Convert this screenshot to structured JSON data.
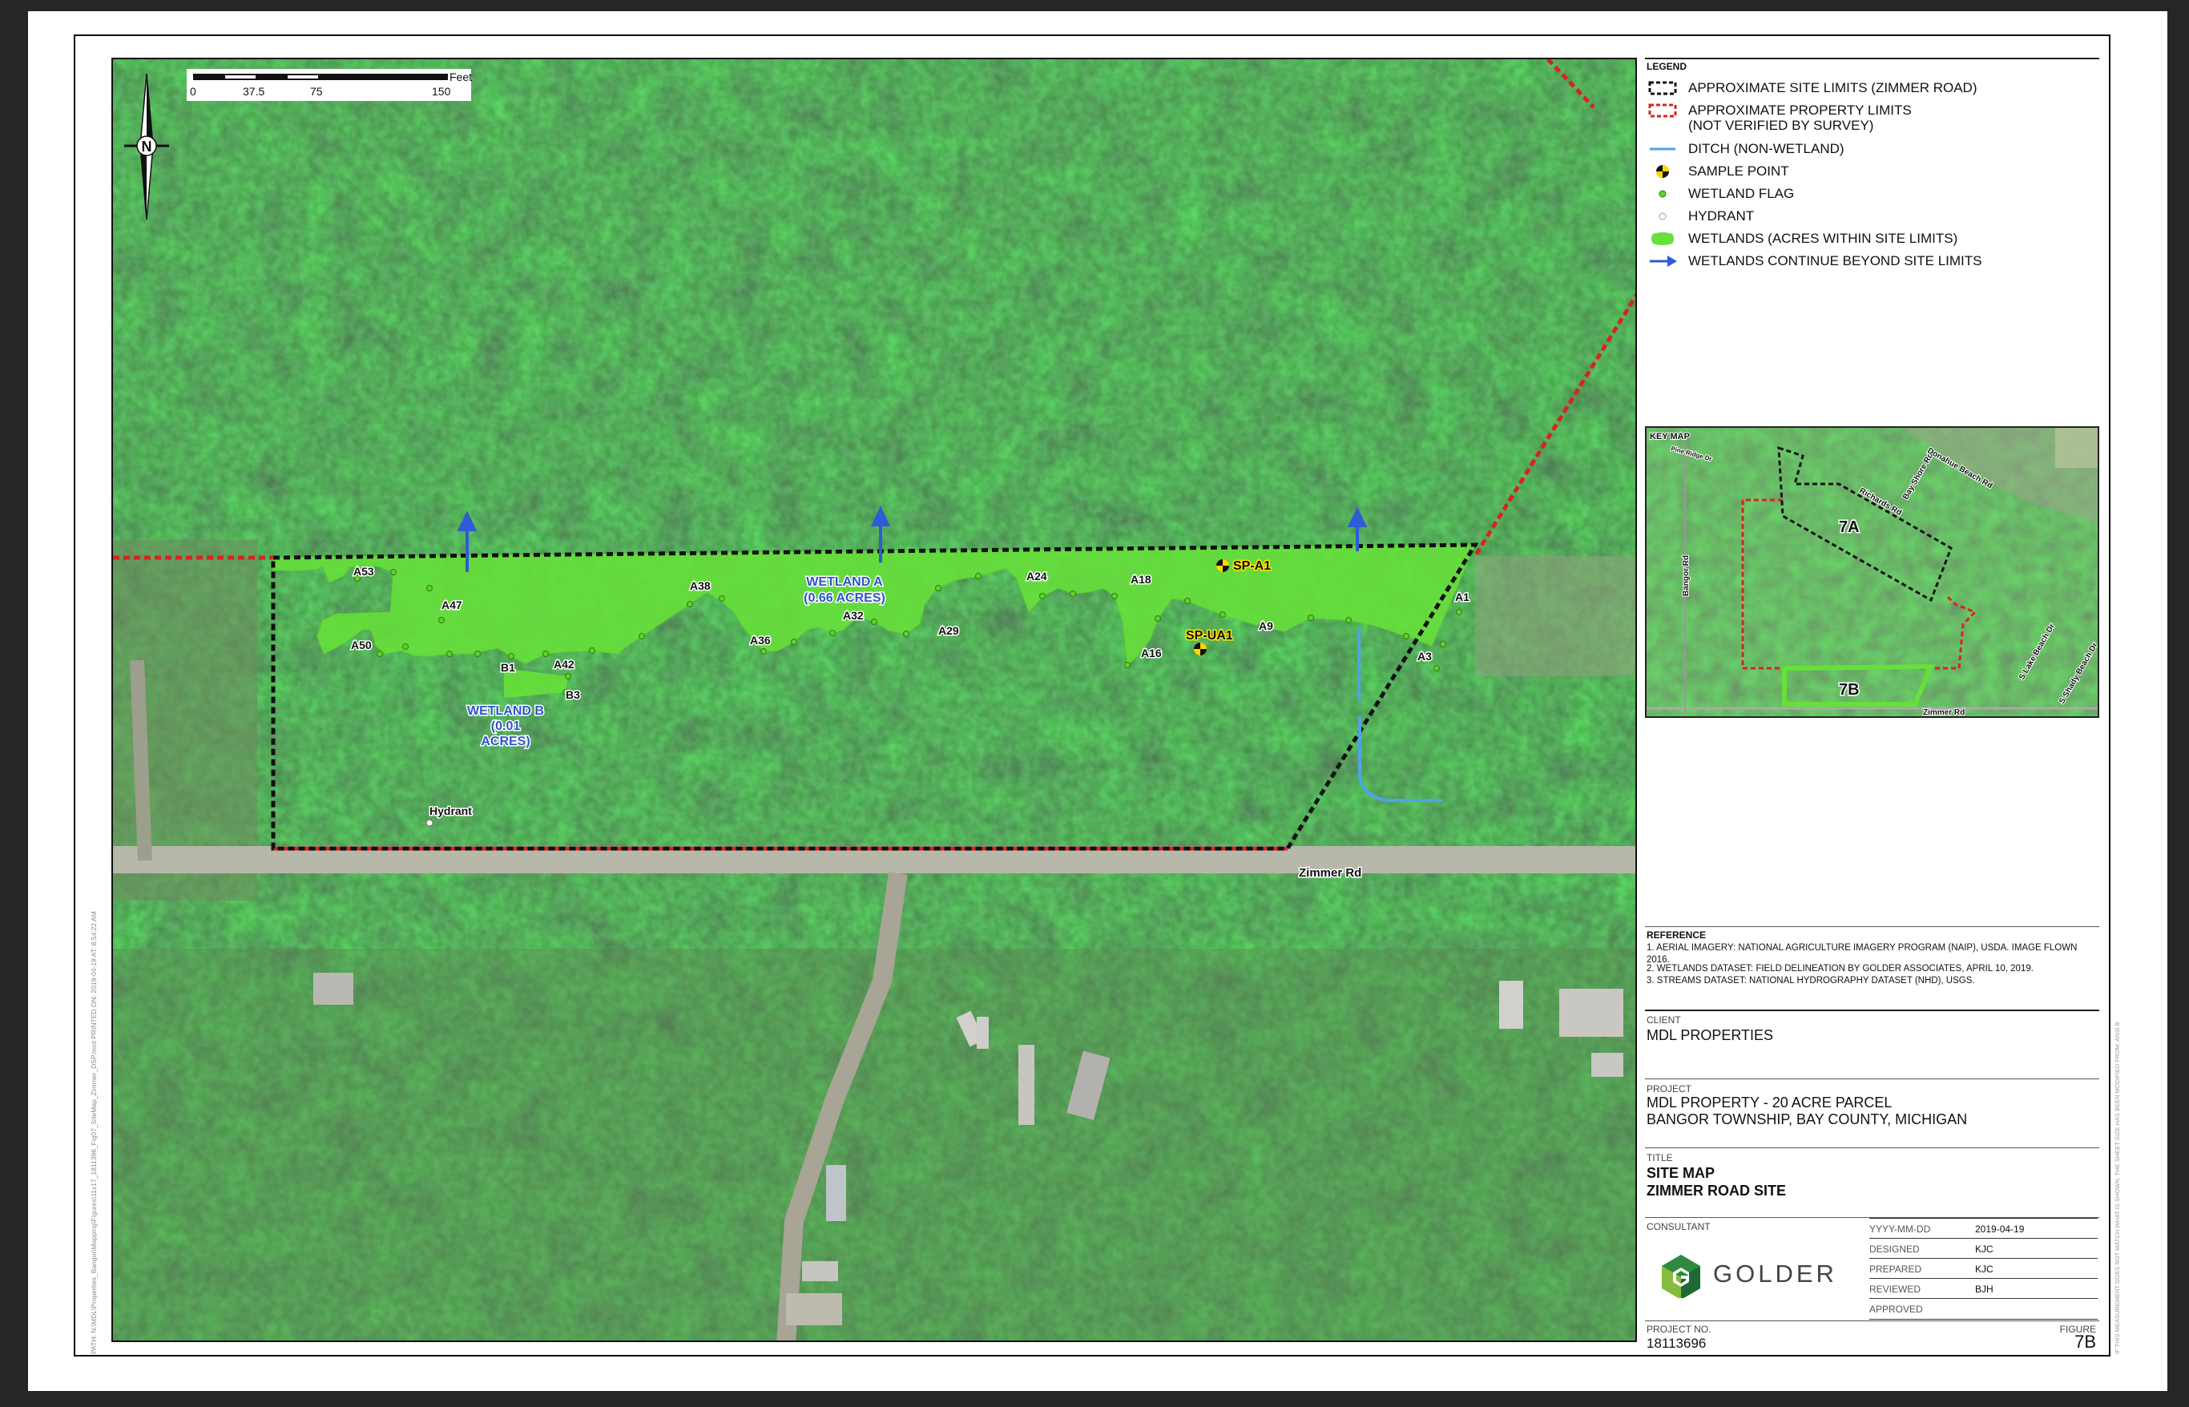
{
  "map": {
    "scalebar": {
      "unit": "Feet",
      "ticks": [
        "0",
        "37.5",
        "75",
        "150"
      ]
    },
    "north_arrow_label": "N",
    "labels": {
      "wetland_a": [
        "WETLAND A",
        "(0.66 ACRES)"
      ],
      "wetland_b": [
        "WETLAND B",
        "(0.01",
        "ACRES)"
      ],
      "sample_points": [
        "SP-A1",
        "SP-UA1"
      ],
      "flags": [
        "A53",
        "A47",
        "A50",
        "A38",
        "A36",
        "A32",
        "A29",
        "A24",
        "A18",
        "A16",
        "A9",
        "A3",
        "A1",
        "B1",
        "A42",
        "B3"
      ],
      "hydrant": "Hydrant",
      "road": "Zimmer Rd"
    }
  },
  "legend": {
    "title": "LEGEND",
    "items": [
      {
        "label": "APPROXIMATE SITE LIMITS (ZIMMER ROAD)",
        "symbol": "black-dashed-box"
      },
      {
        "label": "APPROXIMATE PROPERTY LIMITS",
        "label2": "(NOT VERIFIED BY SURVEY)",
        "symbol": "red-dashed-box"
      },
      {
        "label": "DITCH (NON-WETLAND)",
        "symbol": "blue-line"
      },
      {
        "label": "SAMPLE POINT",
        "symbol": "sample-point-icon"
      },
      {
        "label": "WETLAND FLAG",
        "symbol": "green-dot"
      },
      {
        "label": "HYDRANT",
        "symbol": "white-dot"
      },
      {
        "label": "WETLANDS (ACRES WITHIN SITE LIMITS)",
        "symbol": "green-fill"
      },
      {
        "label": "WETLANDS CONTINUE BEYOND SITE LIMITS",
        "symbol": "blue-arrow"
      }
    ]
  },
  "keymap": {
    "title": "KEY MAP",
    "labels": [
      "7A",
      "7B"
    ],
    "roads": [
      "Bay Shore Rd",
      "Donahue Beach Rd",
      "Richards Rd",
      "Bangor Rd",
      "S Lake Beach Dr",
      "S Shady Beach Dr",
      "Zimmer Rd",
      "Pine Ridge Dr"
    ]
  },
  "reference": {
    "title": "REFERENCE",
    "lines": [
      "1.  AERIAL IMAGERY:  NATIONAL AGRICULTURE IMAGERY PROGRAM (NAIP), USDA.  IMAGE FLOWN 2016.",
      "2.  WETLANDS DATASET:  FIELD DELINEATION BY GOLDER ASSOCIATES, APRIL 10, 2019.",
      "3.  STREAMS DATASET: NATIONAL HYDROGRAPHY DATASET (NHD), USGS."
    ]
  },
  "client": {
    "heading": "CLIENT",
    "name": "MDL PROPERTIES"
  },
  "project": {
    "heading": "PROJECT",
    "line1": "MDL PROPERTY - 20 ACRE PARCEL",
    "line2": "BANGOR TOWNSHIP, BAY COUNTY, MICHIGAN"
  },
  "title_block": {
    "heading": "TITLE",
    "line1": "SITE MAP",
    "line2": "ZIMMER ROAD SITE"
  },
  "consultant": {
    "heading": "CONSULTANT",
    "logo_text": "GOLDER"
  },
  "meta": [
    {
      "label": "YYYY-MM-DD",
      "value": "2019-04-19"
    },
    {
      "label": "DESIGNED",
      "value": "KJC"
    },
    {
      "label": "PREPARED",
      "value": "KJC"
    },
    {
      "label": "REVIEWED",
      "value": "BJH"
    },
    {
      "label": "APPROVED",
      "value": ""
    }
  ],
  "project_no": {
    "heading": "PROJECT NO.",
    "value": "18113696"
  },
  "figure": {
    "heading": "FIGURE",
    "value": "7B"
  },
  "side_note_left": "PATH: N:\\MDL\\Properties_Bangor\\Mapping\\Figures\\11x17_1811396_Fig07_SiteMap_Zimmer_DSP.mxd   PRINTED ON: 2019-04-19 AT: 8:54:22 AM",
  "side_note_right": "IF THIS MEASUREMENT DOES NOT MATCH WHAT IS SHOWN, THE SHEET SIZE HAS BEEN MODIFIED FROM: ANSI B"
}
